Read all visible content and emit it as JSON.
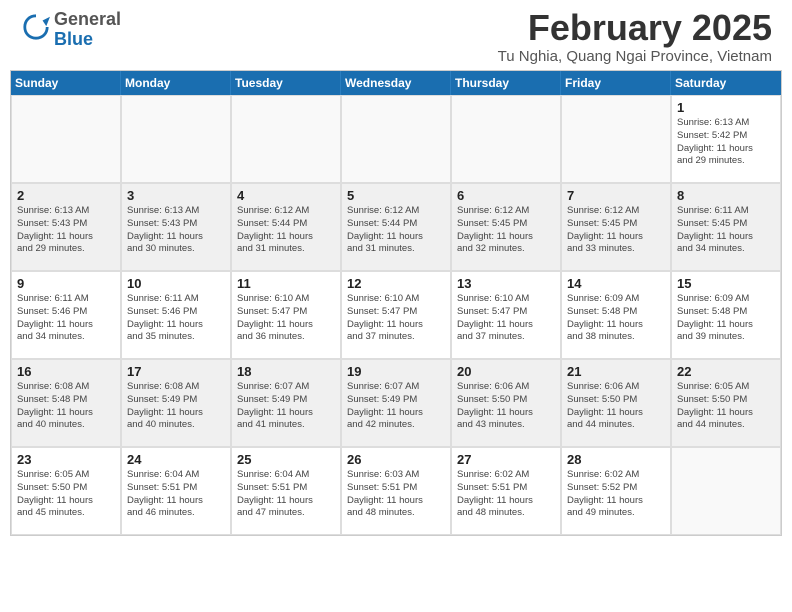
{
  "header": {
    "logo_general": "General",
    "logo_blue": "Blue",
    "month_title": "February 2025",
    "location": "Tu Nghia, Quang Ngai Province, Vietnam"
  },
  "weekdays": [
    "Sunday",
    "Monday",
    "Tuesday",
    "Wednesday",
    "Thursday",
    "Friday",
    "Saturday"
  ],
  "weeks": [
    [
      {
        "day": "",
        "info": ""
      },
      {
        "day": "",
        "info": ""
      },
      {
        "day": "",
        "info": ""
      },
      {
        "day": "",
        "info": ""
      },
      {
        "day": "",
        "info": ""
      },
      {
        "day": "",
        "info": ""
      },
      {
        "day": "1",
        "info": "Sunrise: 6:13 AM\nSunset: 5:42 PM\nDaylight: 11 hours\nand 29 minutes."
      }
    ],
    [
      {
        "day": "2",
        "info": "Sunrise: 6:13 AM\nSunset: 5:43 PM\nDaylight: 11 hours\nand 29 minutes."
      },
      {
        "day": "3",
        "info": "Sunrise: 6:13 AM\nSunset: 5:43 PM\nDaylight: 11 hours\nand 30 minutes."
      },
      {
        "day": "4",
        "info": "Sunrise: 6:12 AM\nSunset: 5:44 PM\nDaylight: 11 hours\nand 31 minutes."
      },
      {
        "day": "5",
        "info": "Sunrise: 6:12 AM\nSunset: 5:44 PM\nDaylight: 11 hours\nand 31 minutes."
      },
      {
        "day": "6",
        "info": "Sunrise: 6:12 AM\nSunset: 5:45 PM\nDaylight: 11 hours\nand 32 minutes."
      },
      {
        "day": "7",
        "info": "Sunrise: 6:12 AM\nSunset: 5:45 PM\nDaylight: 11 hours\nand 33 minutes."
      },
      {
        "day": "8",
        "info": "Sunrise: 6:11 AM\nSunset: 5:45 PM\nDaylight: 11 hours\nand 34 minutes."
      }
    ],
    [
      {
        "day": "9",
        "info": "Sunrise: 6:11 AM\nSunset: 5:46 PM\nDaylight: 11 hours\nand 34 minutes."
      },
      {
        "day": "10",
        "info": "Sunrise: 6:11 AM\nSunset: 5:46 PM\nDaylight: 11 hours\nand 35 minutes."
      },
      {
        "day": "11",
        "info": "Sunrise: 6:10 AM\nSunset: 5:47 PM\nDaylight: 11 hours\nand 36 minutes."
      },
      {
        "day": "12",
        "info": "Sunrise: 6:10 AM\nSunset: 5:47 PM\nDaylight: 11 hours\nand 37 minutes."
      },
      {
        "day": "13",
        "info": "Sunrise: 6:10 AM\nSunset: 5:47 PM\nDaylight: 11 hours\nand 37 minutes."
      },
      {
        "day": "14",
        "info": "Sunrise: 6:09 AM\nSunset: 5:48 PM\nDaylight: 11 hours\nand 38 minutes."
      },
      {
        "day": "15",
        "info": "Sunrise: 6:09 AM\nSunset: 5:48 PM\nDaylight: 11 hours\nand 39 minutes."
      }
    ],
    [
      {
        "day": "16",
        "info": "Sunrise: 6:08 AM\nSunset: 5:48 PM\nDaylight: 11 hours\nand 40 minutes."
      },
      {
        "day": "17",
        "info": "Sunrise: 6:08 AM\nSunset: 5:49 PM\nDaylight: 11 hours\nand 40 minutes."
      },
      {
        "day": "18",
        "info": "Sunrise: 6:07 AM\nSunset: 5:49 PM\nDaylight: 11 hours\nand 41 minutes."
      },
      {
        "day": "19",
        "info": "Sunrise: 6:07 AM\nSunset: 5:49 PM\nDaylight: 11 hours\nand 42 minutes."
      },
      {
        "day": "20",
        "info": "Sunrise: 6:06 AM\nSunset: 5:50 PM\nDaylight: 11 hours\nand 43 minutes."
      },
      {
        "day": "21",
        "info": "Sunrise: 6:06 AM\nSunset: 5:50 PM\nDaylight: 11 hours\nand 44 minutes."
      },
      {
        "day": "22",
        "info": "Sunrise: 6:05 AM\nSunset: 5:50 PM\nDaylight: 11 hours\nand 44 minutes."
      }
    ],
    [
      {
        "day": "23",
        "info": "Sunrise: 6:05 AM\nSunset: 5:50 PM\nDaylight: 11 hours\nand 45 minutes."
      },
      {
        "day": "24",
        "info": "Sunrise: 6:04 AM\nSunset: 5:51 PM\nDaylight: 11 hours\nand 46 minutes."
      },
      {
        "day": "25",
        "info": "Sunrise: 6:04 AM\nSunset: 5:51 PM\nDaylight: 11 hours\nand 47 minutes."
      },
      {
        "day": "26",
        "info": "Sunrise: 6:03 AM\nSunset: 5:51 PM\nDaylight: 11 hours\nand 48 minutes."
      },
      {
        "day": "27",
        "info": "Sunrise: 6:02 AM\nSunset: 5:51 PM\nDaylight: 11 hours\nand 48 minutes."
      },
      {
        "day": "28",
        "info": "Sunrise: 6:02 AM\nSunset: 5:52 PM\nDaylight: 11 hours\nand 49 minutes."
      },
      {
        "day": "",
        "info": ""
      }
    ]
  ]
}
